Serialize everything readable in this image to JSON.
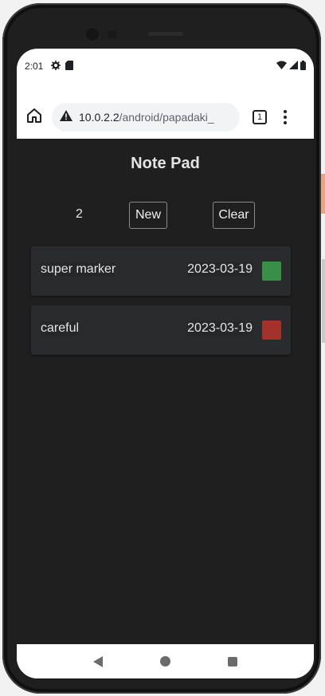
{
  "status_bar": {
    "time": "2:01",
    "icons": [
      "settings-icon",
      "sim-card-icon",
      "wifi-icon",
      "cell-signal-icon",
      "battery-icon"
    ]
  },
  "browser": {
    "url_host": "10.0.2.2",
    "url_path": "/android/papadaki_",
    "tab_count": "1",
    "icons": [
      "home-icon",
      "warning-icon",
      "tab-switcher-icon",
      "more-vert-icon"
    ]
  },
  "app": {
    "title": "Note Pad",
    "count": "2",
    "new_label": "New",
    "clear_label": "Clear",
    "notes": [
      {
        "text": "super marker",
        "date": "2023-03-19",
        "color": "#3a8f46"
      },
      {
        "text": "careful",
        "date": "2023-03-19",
        "color": "#a4312a"
      }
    ],
    "colors": {
      "background": "#1f1f1f",
      "card": "#2a2b2d",
      "text": "#e6e6e6"
    }
  },
  "nav_bar": {
    "icons": [
      "back-icon",
      "home-circle-icon",
      "recents-icon"
    ]
  }
}
